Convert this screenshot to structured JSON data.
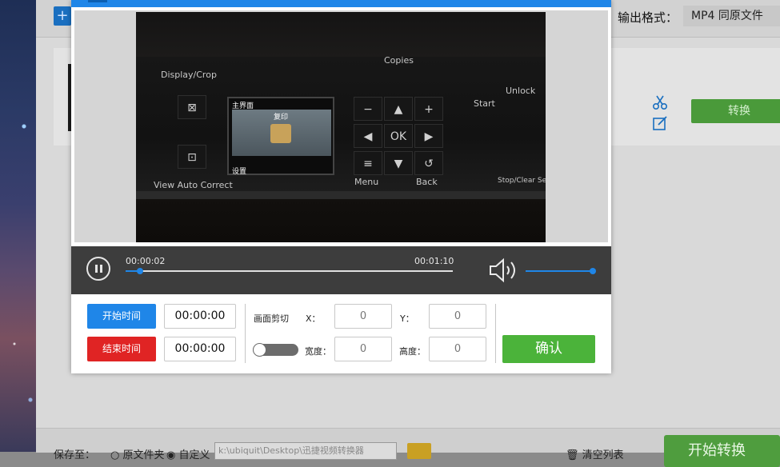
{
  "app": {
    "add_symbol": "+",
    "output_format_label": "输出格式：",
    "output_format_value": "MP4  同原文件",
    "convert_button": "转换",
    "footer": {
      "save_to_label": "保存至：",
      "option_original": "原文件夹",
      "option_custom": "自定义",
      "path_value": "k:\\ubiquit\\Desktop\\迅捷视频转换器",
      "clear_list": "清空列表",
      "start_convert": "开始转换"
    }
  },
  "video_panel": {
    "display_crop": "Display/Crop",
    "view_auto_correct": "View Auto Correct",
    "copies": "Copies",
    "start": "Start",
    "unlock": "Unlock",
    "menu": "Menu",
    "back": "Back",
    "stop_clear": "Stop/Clear Setti",
    "lcd_title": "主界面",
    "lcd_center": "复印",
    "lcd_bottom": "设置",
    "ok": "OK"
  },
  "player": {
    "current_time": "00:00:02",
    "total_time": "00:01:10",
    "progress": 0.045,
    "volume": 1.0
  },
  "controls": {
    "start_time_button": "开始时间",
    "end_time_button": "结束时间",
    "start_time_value": "00:00:00",
    "end_time_value": "00:00:00",
    "crop_label": "画面剪切",
    "x_label": "X：",
    "y_label": "Y：",
    "width_label": "宽度：",
    "height_label": "高度：",
    "x_value": "0",
    "y_value": "0",
    "width_value": "0",
    "height_value": "0",
    "crop_enabled": false,
    "confirm_button": "确认"
  },
  "colors": {
    "accent_blue": "#1f86e8",
    "end_red": "#e02424",
    "confirm_green": "#4bb33a",
    "player_bg": "#3d3d3d"
  }
}
